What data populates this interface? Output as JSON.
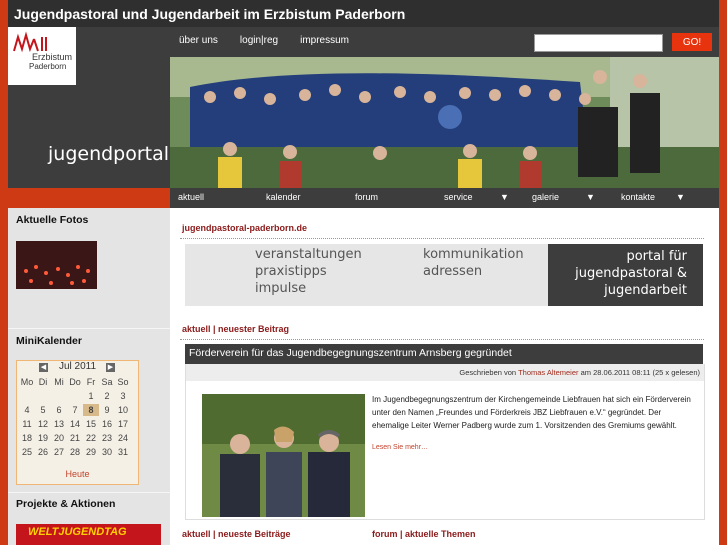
{
  "site": {
    "title": "Jugendpastoral und Jugendarbeit im Erzbistum Paderborn"
  },
  "logo": {
    "line1": "Erzbistum",
    "line2": "Paderborn"
  },
  "brand": {
    "text": "jugendportal"
  },
  "topnav": {
    "items": [
      "über uns",
      "login|reg",
      "impressum"
    ]
  },
  "search": {
    "placeholder": "",
    "value": "",
    "button_label": "GO!"
  },
  "mainnav": {
    "items": [
      "aktuell",
      "kalender",
      "forum",
      "service",
      "galerie",
      "kontakte"
    ]
  },
  "sidebar": {
    "fotos_heading": "Aktuelle Fotos",
    "calendar_heading": "MiniKalender",
    "calendar": {
      "month": "Jul 2011",
      "weekdays": [
        "Mo",
        "Di",
        "Mi",
        "Do",
        "Fr",
        "Sa",
        "So"
      ],
      "weeks": [
        [
          "",
          "",
          "",
          "",
          "1",
          "2",
          "3"
        ],
        [
          "4",
          "5",
          "6",
          "7",
          "8",
          "9",
          "10"
        ],
        [
          "11",
          "12",
          "13",
          "14",
          "15",
          "16",
          "17"
        ],
        [
          "18",
          "19",
          "20",
          "21",
          "22",
          "23",
          "24"
        ],
        [
          "25",
          "26",
          "27",
          "28",
          "29",
          "30",
          "31"
        ]
      ],
      "today": "8",
      "today_label": "Heute"
    },
    "projects_heading": "Projekte & Aktionen",
    "banner_text": "WELTJUGENDTAG"
  },
  "main": {
    "site_crumb": "jugendpastoral-paderborn.de",
    "feature": {
      "col1": [
        "veranstaltungen",
        "praxistipps",
        "impulse"
      ],
      "col2": [
        "kommunikation",
        "adressen"
      ],
      "col3": [
        "portal für",
        "jugendpastoral &",
        "jugendarbeit"
      ]
    },
    "latest_heading": "aktuell | neuester Beitrag",
    "article": {
      "title": "Förderverein für das Jugendbegegnungszentrum Arnsberg gegründet",
      "meta_prefix": "Geschrieben von",
      "author": "Thomas Altemeier",
      "meta_suffix": "am 28.06.2011 08:11 (25 x gelesen)",
      "body": "Im Jugendbegegnungszentrum der Kirchengemeinde Liebfrauen hat sich ein Förderverein unter den Namen „Freundes und Förderkreis JBZ Liebfrauen e.V.“ gegründet. Der ehemalige Leiter Werner Padberg wurde zum 1. Vorsitzenden des Gremiums gewählt.",
      "read_more": "Lesen Sie mehr…"
    },
    "bottom_left_heading": "aktuell | neueste Beiträge",
    "bottom_right_heading": "forum | aktuelle Themen"
  },
  "colors": {
    "accent": "#cd3a14",
    "dark": "#3d3d3d",
    "link": "#8a1a1a"
  }
}
